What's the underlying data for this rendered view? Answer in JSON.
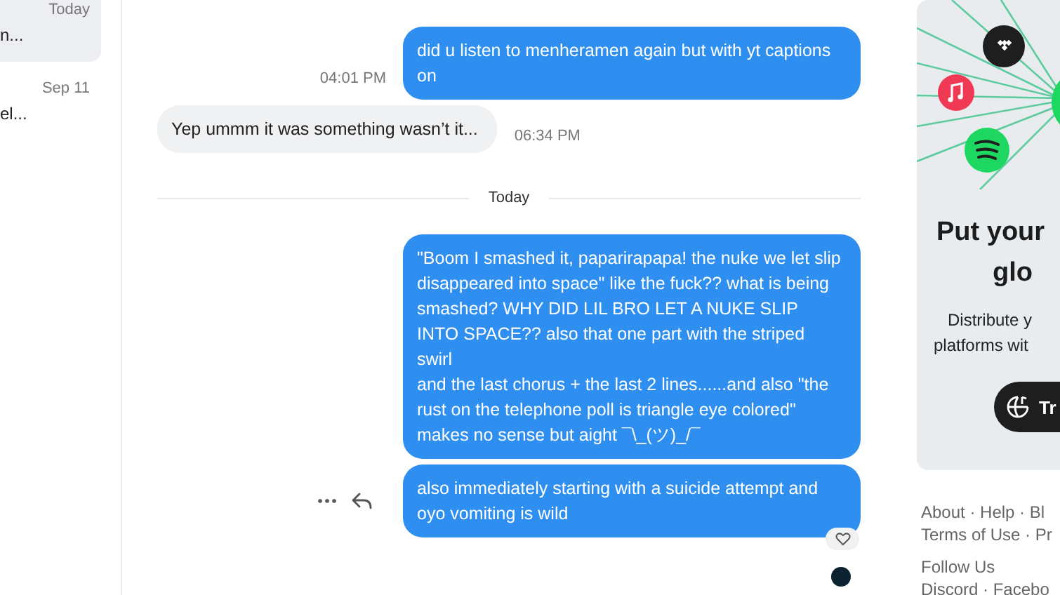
{
  "sidebar": {
    "conversations": [
      {
        "time": "Today",
        "preview": "n...",
        "selected": true
      },
      {
        "time": "Sep 11",
        "preview": "el...",
        "selected": false
      }
    ]
  },
  "messages": [
    {
      "kind": "outgoing",
      "text": "did u listen to menheramen again but with yt captions on",
      "time": "04:01 PM"
    },
    {
      "kind": "incoming",
      "text": "Yep ummm it was something wasn’t it...",
      "time": "06:34 PM"
    },
    {
      "kind": "divider",
      "text": "Today"
    },
    {
      "kind": "outgoing",
      "text": "\"Boom I smashed it, paparirapapa! the nuke we let slip disappeared into space\" like the fuck?? what is being smashed? WHY DID LIL BRO LET A NUKE SLIP INTO SPACE?? also that one part with the striped swirl\nand the last chorus + the last 2 lines......and also \"the rust on the telephone poll is triangle eye colored\" makes no sense but aight ¯\\_(ツ)_/¯"
    },
    {
      "kind": "outgoing",
      "text": "also immediately starting with a suicide attempt and oyo vomiting is wild",
      "show_actions": true,
      "reaction_button": true,
      "read_avatar": true
    }
  ],
  "promo": {
    "headline_lines": [
      "Put your",
      "glo"
    ],
    "description_lines": [
      "Distribute y",
      "platforms wit"
    ],
    "button": "Tr"
  },
  "footer": {
    "link_lines": [
      "About · Help · Bl",
      "Terms of Use · Pr"
    ],
    "follow_label": "Follow Us",
    "social_line": "Discord · Facebo"
  }
}
